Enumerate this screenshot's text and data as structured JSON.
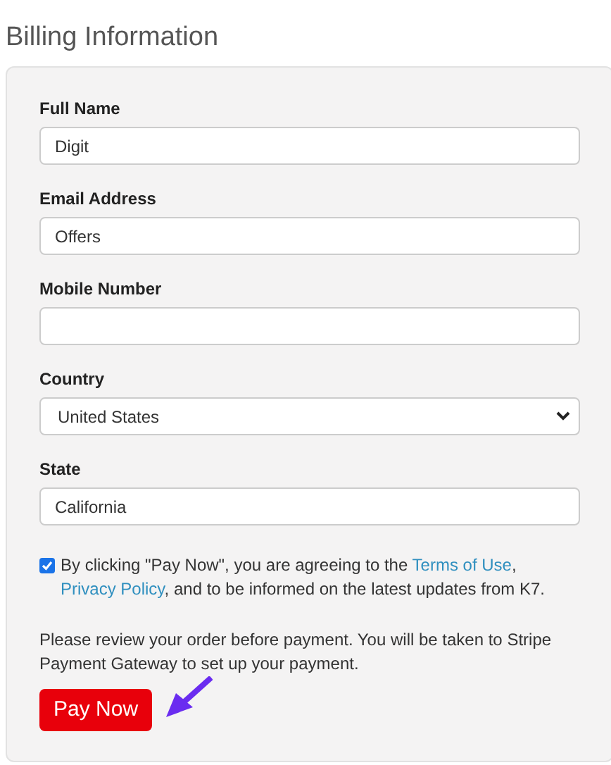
{
  "heading": "Billing Information",
  "fields": [
    {
      "kind": "input",
      "label": "Full Name",
      "value": "Digit"
    },
    {
      "kind": "input",
      "label": "Email Address",
      "value": "Offers"
    },
    {
      "kind": "input",
      "label": "Mobile Number"
    },
    {
      "kind": "select",
      "label": "Country",
      "value": "United States"
    },
    {
      "kind": "input",
      "label": "State",
      "value": "California"
    }
  ],
  "consent": {
    "checked": true,
    "parts": [
      {
        "kind": "text",
        "text": "By clicking \"Pay Now\", you are agreeing to the"
      },
      {
        "kind": "link",
        "text": "Terms of Use"
      },
      {
        "kind": "text",
        "text": ","
      },
      {
        "kind": "link",
        "text": "Privacy Policy"
      },
      {
        "kind": "text",
        "text": ", and to be informed on the latest updates from K7."
      }
    ]
  },
  "notice": "Please review your order before payment. You will be taken to Stripe Payment Gateway to set up your payment.",
  "pay_button": "Pay Now"
}
